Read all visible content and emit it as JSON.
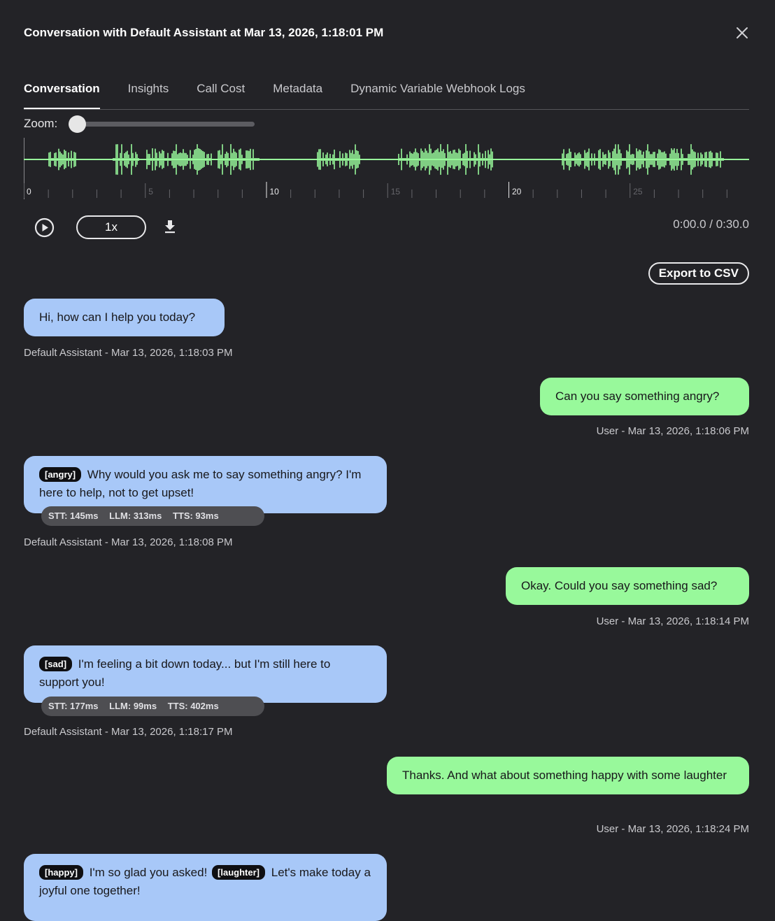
{
  "header": {
    "title": "Conversation with Default Assistant at Mar 13, 2026, 1:18:01 PM",
    "close_icon": "close-icon"
  },
  "tabs": [
    {
      "label": "Conversation",
      "active": true
    },
    {
      "label": "Insights",
      "active": false
    },
    {
      "label": "Call Cost",
      "active": false
    },
    {
      "label": "Metadata",
      "active": false
    },
    {
      "label": "Dynamic Variable Webhook Logs",
      "active": false
    }
  ],
  "zoom": {
    "label": "Zoom:",
    "level": 0
  },
  "waveform": {
    "color": "#98f99b",
    "ticks": [
      "0",
      "5",
      "10",
      "15",
      "20",
      "25"
    ],
    "duration_seconds": 30
  },
  "player": {
    "play_icon": "play-icon",
    "speed": "1x",
    "download_icon": "download-icon",
    "time": "0:00.0 / 0:30.0"
  },
  "export_label": "Export to CSV",
  "colors": {
    "background": "#232327",
    "assistant_bubble": "#a8c8f8",
    "user_bubble": "#98f99b"
  },
  "messages": [
    {
      "role": "assistant",
      "parts": [
        {
          "text": "Hi, how can I help you today?"
        }
      ],
      "meta": "Default Assistant - Mar 13, 2026, 1:18:03 PM"
    },
    {
      "role": "user",
      "parts": [
        {
          "text": "Can you say something angry?"
        }
      ],
      "meta": "User - Mar 13, 2026, 1:18:06 PM"
    },
    {
      "role": "assistant",
      "parts": [
        {
          "tag": "[angry]"
        },
        {
          "text": "Why would you ask me to say something angry? I'm here to help, not to get upset!"
        }
      ],
      "latency": [
        "STT: 145ms",
        "LLM: 313ms",
        "TTS: 93ms"
      ],
      "meta": "Default Assistant - Mar 13, 2026, 1:18:08 PM"
    },
    {
      "role": "user",
      "parts": [
        {
          "text": "Okay. Could you say something sad?"
        }
      ],
      "meta": "User - Mar 13, 2026, 1:18:14 PM"
    },
    {
      "role": "assistant",
      "parts": [
        {
          "tag": "[sad]"
        },
        {
          "text": "I'm feeling a bit down today... but I'm still here to support you!"
        }
      ],
      "latency": [
        "STT: 177ms",
        "LLM: 99ms",
        "TTS: 402ms"
      ],
      "meta": "Default Assistant - Mar 13, 2026, 1:18:17 PM"
    },
    {
      "role": "user",
      "parts": [
        {
          "text": "Thanks. And what about something happy with some laughter"
        }
      ],
      "meta": "User - Mar 13, 2026, 1:18:24 PM"
    },
    {
      "role": "assistant",
      "parts": [
        {
          "tag": "[happy]"
        },
        {
          "text": "I'm so glad you asked!"
        },
        {
          "tag": "[laughter]"
        },
        {
          "text": " Let's make today a joyful one together!"
        }
      ]
    }
  ]
}
